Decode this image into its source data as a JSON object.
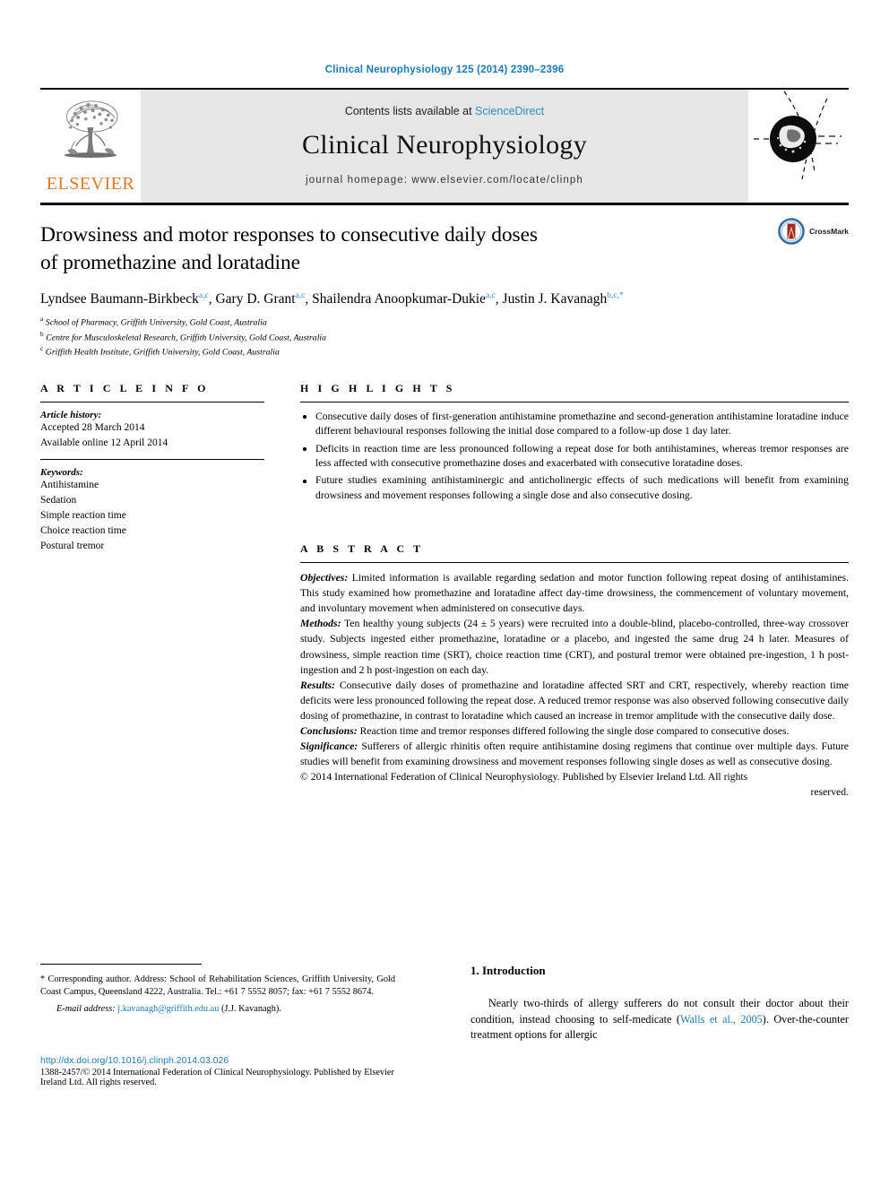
{
  "running_head": "Clinical Neurophysiology 125 (2014) 2390–2396",
  "masthead": {
    "contents_prefix": "Contents lists available at ",
    "sciencedirect": "ScienceDirect",
    "journal_name": "Clinical Neurophysiology",
    "homepage": "journal homepage: www.elsevier.com/locate/clinph",
    "publisher_logo_text": "ELSEVIER",
    "accent_blue": "#1a7bb9",
    "elsevier_orange": "#e87722"
  },
  "article": {
    "title_line1": "Drowsiness and motor responses to consecutive daily doses",
    "title_line2": "of promethazine and loratadine",
    "crossmark_label": "CrossMark",
    "authors": [
      {
        "name": "Lyndsee Baumann-Birkbeck",
        "sup": "a,c",
        "sep": ", "
      },
      {
        "name": "Gary D. Grant",
        "sup": "a,c",
        "sep": ", "
      },
      {
        "name": "Shailendra Anoopkumar-Dukie",
        "sup": "a,c",
        "sep": ", "
      },
      {
        "name": "Justin J. Kavanagh",
        "sup": "b,c,*",
        "sep": ""
      }
    ],
    "affiliations": [
      {
        "mark": "a",
        "text": "School of Pharmacy, Griffith University, Gold Coast, Australia"
      },
      {
        "mark": "b",
        "text": "Centre for Musculoskeletal Research, Griffith University, Gold Coast, Australia"
      },
      {
        "mark": "c",
        "text": "Griffith Health Institute, Griffith University, Gold Coast, Australia"
      }
    ]
  },
  "article_info": {
    "heading": "A R T I C L E   I N F O",
    "history_label": "Article history:",
    "history": [
      "Accepted 28 March 2014",
      "Available online 12 April 2014"
    ],
    "keywords_label": "Keywords:",
    "keywords": [
      "Antihistamine",
      "Sedation",
      "Simple reaction time",
      "Choice reaction time",
      "Postural tremor"
    ]
  },
  "highlights": {
    "heading": "H I G H L I G H T S",
    "items": [
      "Consecutive daily doses of first-generation antihistamine promethazine and second-generation antihistamine loratadine induce different behavioural responses following the initial dose compared to a follow-up dose 1 day later.",
      "Deficits in reaction time are less pronounced following a repeat dose for both antihistamines, whereas tremor responses are less affected with consecutive promethazine doses and exacerbated with consecutive loratadine doses.",
      "Future studies examining antihistaminergic and anticholinergic effects of such medications will benefit from examining drowsiness and movement responses following a single dose and also consecutive dosing."
    ]
  },
  "abstract": {
    "heading": "A B S T R A C T",
    "sections": [
      {
        "label": "Objectives:",
        "text": " Limited information is available regarding sedation and motor function following repeat dosing of antihistamines. This study examined how promethazine and loratadine affect day-time drowsiness, the commencement of voluntary movement, and involuntary movement when administered on consecutive days."
      },
      {
        "label": "Methods:",
        "text": " Ten healthy young subjects (24 ± 5 years) were recruited into a double-blind, placebo-controlled, three-way crossover study. Subjects ingested either promethazine, loratadine or a placebo, and ingested the same drug 24 h later. Measures of drowsiness, simple reaction time (SRT), choice reaction time (CRT), and postural tremor were obtained pre-ingestion, 1 h post-ingestion and 2 h post-ingestion on each day."
      },
      {
        "label": "Results:",
        "text": " Consecutive daily doses of promethazine and loratadine affected SRT and CRT, respectively, whereby reaction time deficits were less pronounced following the repeat dose. A reduced tremor response was also observed following consecutive daily dosing of promethazine, in contrast to loratadine which caused an increase in tremor amplitude with the consecutive daily dose."
      },
      {
        "label": "Conclusions:",
        "text": " Reaction time and tremor responses differed following the single dose compared to consecutive doses."
      },
      {
        "label": "Significance:",
        "text": " Sufferers of allergic rhinitis often require antihistamine dosing regimens that continue over multiple days. Future studies will benefit from examining drowsiness and movement responses following single doses as well as consecutive dosing."
      }
    ],
    "copyright_main": "© 2014 International Federation of Clinical Neurophysiology. Published by Elsevier Ireland Ltd. All rights",
    "copyright_last": "reserved."
  },
  "footnotes": {
    "corresponding": "* Corresponding author. Address: School of Rehabilitation Sciences, Griffith University, Gold Coast Campus, Queensland 4222, Australia. Tel.: +61 7 5552 8057; fax: +61 7 5552 8674.",
    "email_label": "E-mail address:",
    "email": "j.kavanagh@griffith.edu.au",
    "email_owner": "(J.J. Kavanagh)."
  },
  "publication_footer": {
    "doi": "http://dx.doi.org/10.1016/j.clinph.2014.03.026",
    "issn_line": "1388-2457/© 2014 International Federation of Clinical Neurophysiology. Published by Elsevier Ireland Ltd. All rights reserved."
  },
  "introduction": {
    "heading": "1. Introduction",
    "para_part1": "Nearly two-thirds of allergy sufferers do not consult their doctor about their condition, instead choosing to self-medicate (",
    "citation": "Walls et al., 2005",
    "para_part2": "). Over-the-counter treatment options for allergic"
  }
}
